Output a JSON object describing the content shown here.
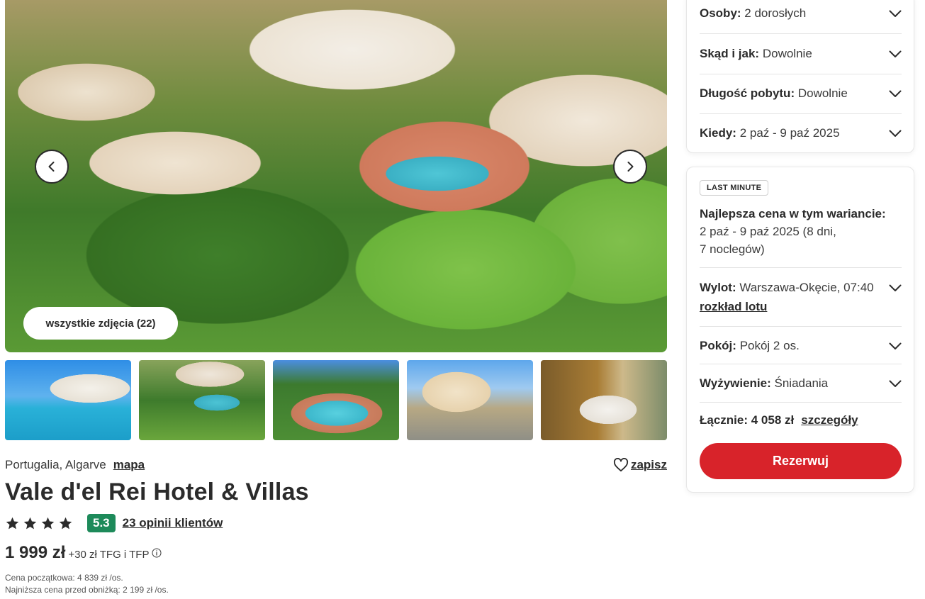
{
  "gallery": {
    "all_photos_label": "wszystkie zdjęcia (22)",
    "thumbnails": [
      "pool-photo",
      "aerial-photo",
      "pool-aerial-photo",
      "building-photo",
      "room-photo"
    ]
  },
  "hotel": {
    "location": "Portugalia, Algarve",
    "map_label": "mapa",
    "save_label": "zapisz",
    "name": "Vale d'el Rei Hotel & Villas",
    "stars": 4,
    "score": "5.3",
    "reviews_label": "23 opinii klientów",
    "price": "1 999 zł",
    "price_extra": "+30 zł TFG i TFP",
    "initial_price_note": "Cena początkowa: 4 839 zł /os.",
    "lowest_price_note": "Najniższa cena przed obniżką: 2 199 zł /os."
  },
  "filters": {
    "persons": {
      "label": "Osoby:",
      "value": "2 dorosłych"
    },
    "from": {
      "label": "Skąd i jak:",
      "value": "Dowolnie"
    },
    "duration": {
      "label": "Długość pobytu:",
      "value": "Dowolnie"
    },
    "when": {
      "label": "Kiedy:",
      "value": "2 paź - 9 paź 2025"
    }
  },
  "offer": {
    "badge": "LAST MINUTE",
    "best_title": "Najlepsza cena w tym wariancie:",
    "best_line1": "2 paź - 9 paź 2025 (8 dni,",
    "best_line2": "7 noclegów)",
    "flight": {
      "label": "Wylot:",
      "value": "Warszawa-Okęcie, 07:40"
    },
    "flight_link": "rozkład lotu",
    "room": {
      "label": "Pokój:",
      "value": "Pokój 2 os."
    },
    "board": {
      "label": "Wyżywienie:",
      "value": "Śniadania"
    },
    "total_label": "Łącznie: 4 058 zł",
    "details_label": "szczegóły",
    "book_label": "Rezerwuj"
  },
  "colors": {
    "book_button": "#d8232a",
    "score_badge": "#1d8a5a",
    "text": "#2b2b2b"
  }
}
